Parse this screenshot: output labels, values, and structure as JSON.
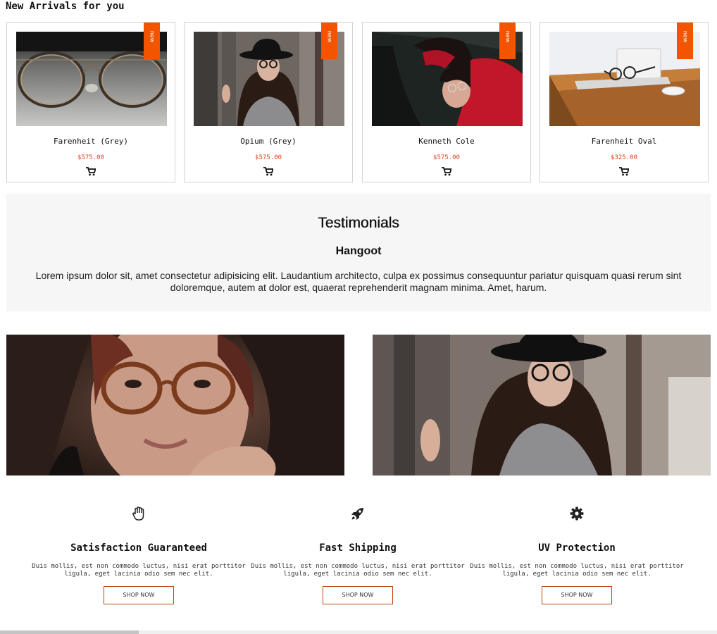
{
  "new_arrivals": {
    "title": "New Arrivals for you",
    "badge_label": "new",
    "products": [
      {
        "name": "Farenheit (Grey)",
        "price": "$575.00"
      },
      {
        "name": "Opium (Grey)",
        "price": "$575.00"
      },
      {
        "name": "Kenneth Cole",
        "price": "$575.00"
      },
      {
        "name": "Farenheit Oval",
        "price": "$325.00"
      }
    ]
  },
  "testimonials": {
    "title": "Testimonials",
    "author": "Hangoot",
    "quote": "Lorem ipsum dolor sit, amet consectetur adipisicing elit. Laudantium architecto, culpa ex possimus consequuntur pariatur quisquam quasi rerum sint doloremque, autem at dolor est, quaerat reprehenderit magnam minima. Amet, harum."
  },
  "features": [
    {
      "icon": "hand-icon",
      "title": "Satisfaction Guaranteed",
      "text": "Duis mollis, est non commodo luctus, nisi erat porttitor ligula, eget lacinia odio sem nec elit.",
      "button": "SHOP NOW"
    },
    {
      "icon": "rocket-icon",
      "title": "Fast Shipping",
      "text": "Duis mollis, est non commodo luctus, nisi erat porttitor ligula, eget lacinia odio sem nec elit.",
      "button": "SHOP NOW"
    },
    {
      "icon": "gear-icon",
      "title": "UV Protection",
      "text": "Duis mollis, est non commodo luctus, nisi erat porttitor ligula, eget lacinia odio sem nec elit.",
      "button": "SHOP NOW"
    }
  ],
  "colors": {
    "accent": "#f25400",
    "price": "#e8421b",
    "button_border": "#c1440e",
    "testimonial_bg": "#f6f6f6"
  }
}
